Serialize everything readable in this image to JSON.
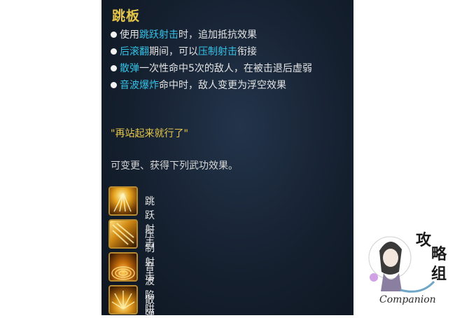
{
  "title": "跳板",
  "bullets": [
    {
      "segments": [
        {
          "text": "使用",
          "hl": false
        },
        {
          "text": "跳跃射击",
          "hl": true
        },
        {
          "text": "时，追加抵抗效果",
          "hl": false
        }
      ]
    },
    {
      "segments": [
        {
          "text": "后滚翻",
          "hl": true
        },
        {
          "text": "期间，可以",
          "hl": false
        },
        {
          "text": "压制射击",
          "hl": true
        },
        {
          "text": "衔接",
          "hl": false
        }
      ]
    },
    {
      "segments": [
        {
          "text": "散弹",
          "hl": true
        },
        {
          "text": "一次性命中5次的敌人，在被击退后虚弱",
          "hl": false
        }
      ]
    },
    {
      "segments": [
        {
          "text": "音波爆炸",
          "hl": true
        },
        {
          "text": "命中时，敌人变更为浮空效果",
          "hl": false
        }
      ]
    }
  ],
  "quote": "\"再站起来就行了\"",
  "description": "可变更、获得下列武功效果。",
  "skills": [
    {
      "label": "跳跃射击",
      "icon": "jump-shot-skill-icon"
    },
    {
      "label": "压制射击",
      "icon": "suppressing-fire-skill-icon"
    },
    {
      "label": "音波陷阱",
      "icon": "sonic-trap-skill-icon"
    },
    {
      "label": "散弹",
      "icon": "scatter-shot-skill-icon"
    }
  ],
  "watermark": {
    "text": "Companion",
    "logo_text": "攻略组"
  },
  "colors": {
    "highlight": "#35c1e6",
    "gold": "#e6c64a",
    "panel": "#15202f"
  }
}
